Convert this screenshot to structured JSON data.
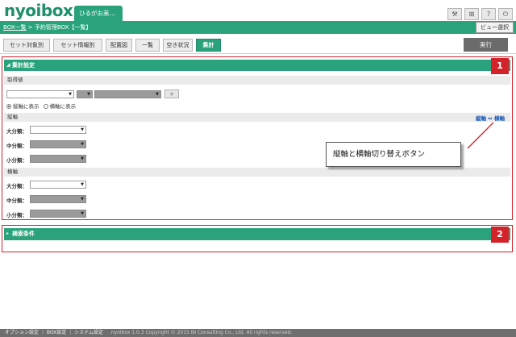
{
  "app": {
    "logo": "nyoibox",
    "user_tab": "ひるがお美…"
  },
  "header": {
    "buttons": [
      {
        "name": "hammer-icon",
        "glyph": "⚒"
      },
      {
        "name": "sitemap-icon",
        "glyph": "⊞"
      },
      {
        "name": "help-icon",
        "glyph": "?"
      },
      {
        "name": "power-icon",
        "glyph": "⏻"
      }
    ]
  },
  "breadcrumb": {
    "link": "BOX一覧",
    "sep": " > ",
    "current": "予約管理BOX【一覧】",
    "view_select": "ビュー選択"
  },
  "tabs": [
    "セット対象別",
    "セット情報別",
    "配置図",
    "一覧",
    "空き状況",
    "集計"
  ],
  "active_tab": "集計",
  "exec_label": "実行",
  "aggregate": {
    "title": "集計設定",
    "badge": "1",
    "acquisition_label": "取得値",
    "radio_vertical": "縦軸に表示",
    "radio_horizontal": "横軸に表示",
    "swap_link": "縦軸 ⇔ 横軸",
    "vertical_axis": {
      "title": "縦軸",
      "large": "大分類：",
      "medium": "中分類：",
      "small": "小分類："
    },
    "horizontal_axis": {
      "title": "横軸",
      "large": "大分類：",
      "medium": "中分類：",
      "small": "小分類："
    }
  },
  "callout": "縦軸と横軸切り替えボタン",
  "search": {
    "title": "検索条件",
    "badge": "2"
  },
  "footer": {
    "option": "オプション設定",
    "box": "BOX設定",
    "system": "システム設定",
    "copyright": "nyoibox 1.0.3 Copyright © 2015 NI Consulting Co., Ltd. All rights reserved."
  },
  "colors": {
    "accent": "#2aa37c",
    "annotation": "#d3232a",
    "link": "#1a56b8"
  }
}
